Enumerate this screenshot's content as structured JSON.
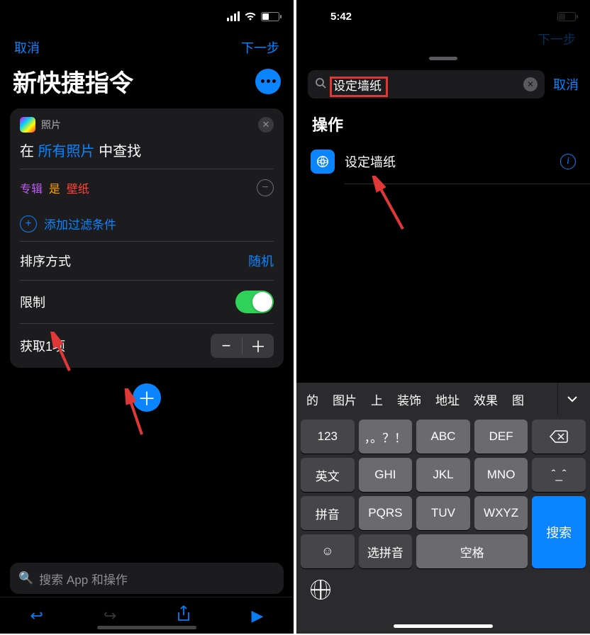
{
  "left": {
    "nav": {
      "cancel": "取消",
      "next": "下一步"
    },
    "title": "新快捷指令",
    "card": {
      "app_name": "照片",
      "find_pre": "在",
      "find_scope": "所有照片",
      "find_post": "中查找",
      "filter_album": "专辑",
      "filter_is": "是",
      "filter_value": "壁纸",
      "add_filter": "添加过滤条件",
      "sort_label": "排序方式",
      "sort_value": "随机",
      "limit_label": "限制",
      "get_label": "获取1项"
    },
    "search_placeholder": "搜索 App 和操作"
  },
  "right": {
    "time": "5:42",
    "nav_next": "下一步",
    "search_value": "设定墙纸",
    "cancel": "取消",
    "section": "操作",
    "result_label": "设定墙纸",
    "candidates": [
      "的",
      "图片",
      "上",
      "装饰",
      "地址",
      "效果",
      "图"
    ],
    "keys_row1": [
      "123",
      "，。？！",
      "ABC",
      "DEF"
    ],
    "keys_row2": [
      "英文",
      "GHI",
      "JKL",
      "MNO"
    ],
    "keys_row3": [
      "拼音",
      "PQRS",
      "TUV",
      "WXYZ"
    ],
    "key_search": "搜索",
    "key_select": "选拼音",
    "key_space": "空格"
  }
}
